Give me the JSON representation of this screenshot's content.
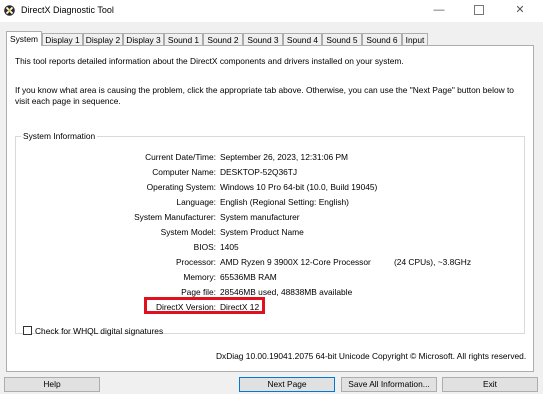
{
  "window": {
    "title": "DirectX Diagnostic Tool",
    "controls": {
      "minimize": "—",
      "close": "✕"
    }
  },
  "tabs": [
    "System",
    "Display 1",
    "Display 2",
    "Display 3",
    "Sound 1",
    "Sound 2",
    "Sound 3",
    "Sound 4",
    "Sound 5",
    "Sound 6",
    "Input"
  ],
  "active_tab": "System",
  "intro": {
    "line1": "This tool reports detailed information about the DirectX components and drivers installed on your system.",
    "line2": "If you know what area is causing the problem, click the appropriate tab above.  Otherwise, you can use the \"Next Page\" button below to visit each page in sequence."
  },
  "system_info": {
    "group_label": "System Information",
    "rows": [
      {
        "label": "Current Date/Time:",
        "value": "September 26, 2023, 12:31:06 PM"
      },
      {
        "label": "Computer Name:",
        "value": "DESKTOP-52Q36TJ"
      },
      {
        "label": "Operating System:",
        "value": "Windows 10 Pro 64-bit (10.0, Build 19045)"
      },
      {
        "label": "Language:",
        "value": "English (Regional Setting: English)"
      },
      {
        "label": "System Manufacturer:",
        "value": "System manufacturer"
      },
      {
        "label": "System Model:",
        "value": "System Product Name"
      },
      {
        "label": "BIOS:",
        "value": "1405"
      },
      {
        "label": "Processor:",
        "value": "AMD Ryzen 9 3900X 12-Core Processor",
        "extra": "(24 CPUs), ~3.8GHz"
      },
      {
        "label": "Memory:",
        "value": "65536MB RAM"
      },
      {
        "label": "Page file:",
        "value": "28546MB used, 48838MB available"
      },
      {
        "label": "DirectX Version:",
        "value": "DirectX 12"
      }
    ],
    "highlight_color": "#e0101e"
  },
  "whql": {
    "label": "Check for WHQL digital signatures",
    "checked": false
  },
  "footer": {
    "dxdiag_version": "DxDiag 10.00.19041.2075 64-bit Unicode  Copyright © Microsoft. All rights reserved."
  },
  "buttons": {
    "help": "Help",
    "next_page": "Next Page",
    "save_all": "Save All Information...",
    "exit": "Exit"
  }
}
